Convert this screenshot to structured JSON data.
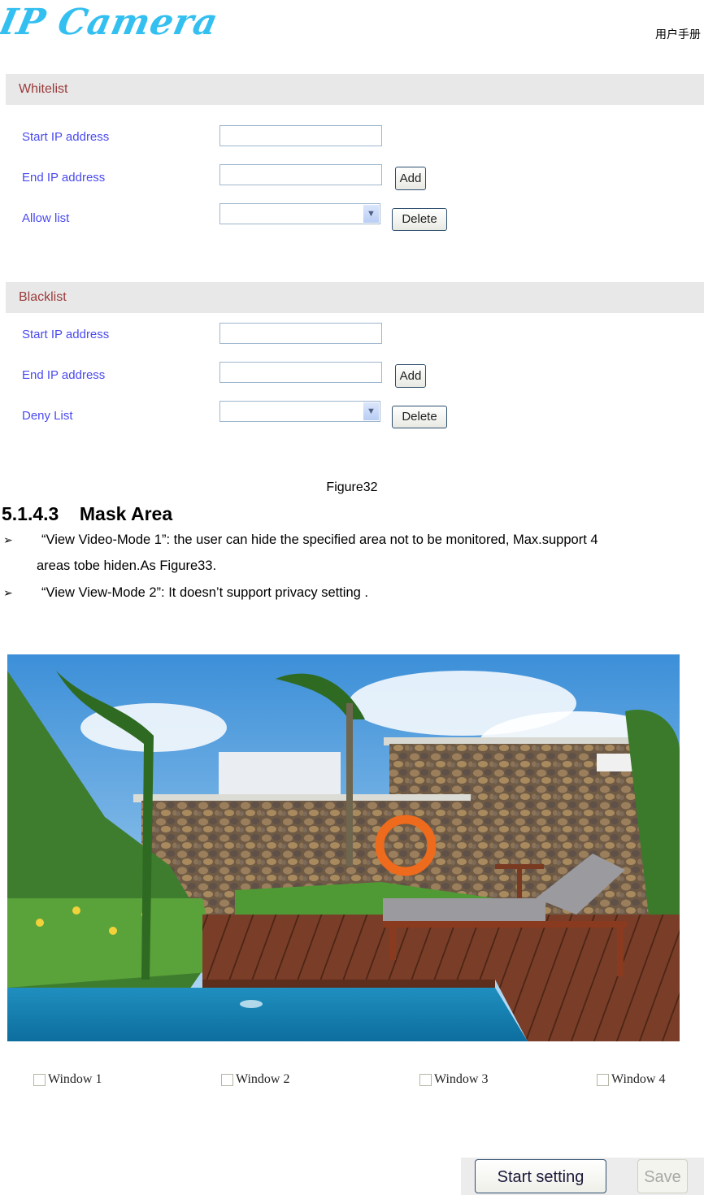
{
  "header": {
    "logo_text": "IP Camera",
    "right_text": "用户手册"
  },
  "whitelist": {
    "title": "Whitelist",
    "start_ip_label": "Start IP address",
    "start_ip_value": "",
    "end_ip_label": "End IP address",
    "end_ip_value": "",
    "list_label": "Allow list",
    "list_selected": "",
    "add_label": "Add",
    "delete_label": "Delete"
  },
  "blacklist": {
    "title": "Blacklist",
    "start_ip_label": "Start IP address",
    "start_ip_value": "",
    "end_ip_label": "End IP address",
    "end_ip_value": "",
    "list_label": "Deny List",
    "list_selected": "",
    "add_label": "Add",
    "delete_label": "Delete"
  },
  "document": {
    "figure_caption": "Figure32",
    "section_heading": "5.1.4.3    Mask Area",
    "bullets": [
      {
        "marker": "➢",
        "line1": "“View Video-Mode 1”: the user can hide the specified area not to be monitored, Max.support 4",
        "line2": "areas tobe hiden.As Figure33."
      },
      {
        "marker": "➢",
        "line1": "“View View-Mode 2”: It doesn’t support privacy setting ."
      }
    ]
  },
  "mask_area": {
    "image_description": "Camera view: pool deck with stone wall, palm trees, orange life ring and grey lounge chair",
    "windows": [
      {
        "label": "Window 1",
        "checked": false
      },
      {
        "label": "Window 2",
        "checked": false
      },
      {
        "label": "Window 3",
        "checked": false
      },
      {
        "label": "Window 4",
        "checked": false
      }
    ],
    "start_setting_label": "Start setting",
    "save_label": "Save"
  },
  "colors": {
    "logo": "#33bff0",
    "section_title": "#9a3a3a",
    "field_label": "#4a4af0",
    "section_bar_bg": "#e8e8e8"
  }
}
